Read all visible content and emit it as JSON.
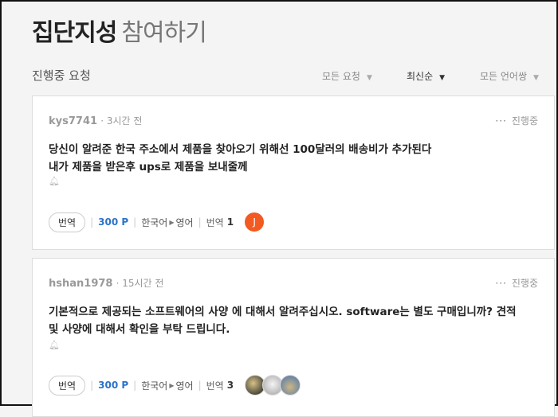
{
  "header": {
    "title_bold": "집단지성",
    "title_light": "참여하기"
  },
  "subbar": {
    "label": "진행중 요청",
    "filters": [
      {
        "label": "모든 요청",
        "active": false
      },
      {
        "label": "최신순",
        "active": true
      },
      {
        "label": "모든 언어쌍",
        "active": false
      }
    ]
  },
  "requests": [
    {
      "user": "kys7741",
      "time": "· 3시간 전",
      "status": "진행중",
      "lines": [
        "당신이 알려준 한국 주소에서 제품을 찾아오기 위해선 100달러의 배송비가 추가된다",
        "내가 제품을 받은후 ups로 제품을 보내줄께"
      ],
      "translate_label": "번역",
      "points": "300 P",
      "source_lang": "한국어",
      "target_lang": "영어",
      "count_label": "번역",
      "count": "1",
      "avatar_initial": "J"
    },
    {
      "user": "hshan1978",
      "time": "· 15시간 전",
      "status": "진행중",
      "lines": [
        "기본적으로 제공되는 소프트웨어의 사양 에 대해서 알려주십시오. software는 별도 구매입니까? 견적",
        "및 사양에 대해서 확인을 부탁 드립니다."
      ],
      "translate_label": "번역",
      "points": "300 P",
      "source_lang": "한국어",
      "target_lang": "영어",
      "count_label": "번역",
      "count": "3"
    }
  ],
  "colors": {
    "accent": "#2b73c9",
    "avatar_j": "#f25a22"
  }
}
